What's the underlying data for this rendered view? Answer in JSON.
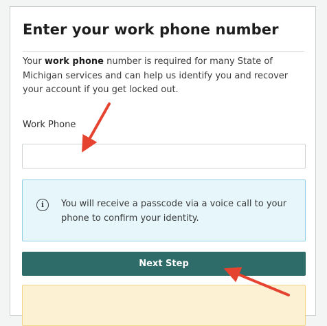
{
  "header": {
    "title": "Enter your work phone number"
  },
  "description": {
    "before": "Your ",
    "bold": "work phone",
    "after": " number is required for many State of Michigan services and can help us identify you and recover your account if you get locked out."
  },
  "form": {
    "phone_label": "Work Phone",
    "phone_value": ""
  },
  "info": {
    "icon": "info-circle-icon",
    "icon_glyph": "i",
    "text": "You will receive a passcode via a voice call to your phone to confirm your identity."
  },
  "actions": {
    "next_label": "Next Step"
  },
  "colors": {
    "button_bg": "#2d6c68",
    "info_bg": "#e6f6fb",
    "info_border": "#8fd0e6",
    "warning_bg": "#fdf1d4",
    "annotation_arrow": "#e5432f"
  }
}
